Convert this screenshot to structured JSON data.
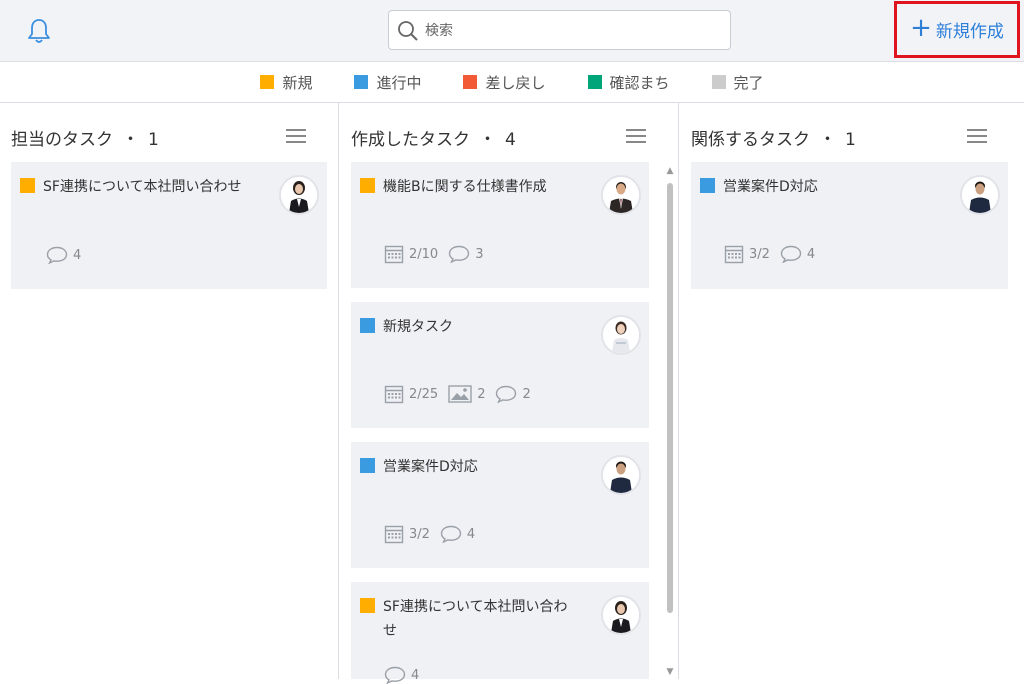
{
  "header": {
    "search_placeholder": "検索",
    "new_button_label": "新規作成"
  },
  "legend": [
    {
      "label": "新規",
      "color": "#ffae00"
    },
    {
      "label": "進行中",
      "color": "#3b9be0"
    },
    {
      "label": "差し戻し",
      "color": "#f15a35"
    },
    {
      "label": "確認まち",
      "color": "#00a679"
    },
    {
      "label": "完了",
      "color": "#cccccc"
    }
  ],
  "columns": [
    {
      "title": "担当のタスク",
      "separator": "・",
      "count": "1",
      "cards": [
        {
          "title": "SF連携について本社問い合わせ",
          "status_color": "#ffae00",
          "comments": "4",
          "avatar": "woman-suit"
        }
      ]
    },
    {
      "title": "作成したタスク",
      "separator": "・",
      "count": "4",
      "cards": [
        {
          "title": "機能Bに関する仕様書作成",
          "status_color": "#ffae00",
          "date": "2/10",
          "comments": "3",
          "avatar": "man-suit"
        },
        {
          "title": "新規タスク",
          "status_color": "#3b9be0",
          "date": "2/25",
          "images": "2",
          "comments": "2",
          "avatar": "woman-white"
        },
        {
          "title": "営業案件D対応",
          "status_color": "#3b9be0",
          "date": "3/2",
          "comments": "4",
          "avatar": "man-casual"
        },
        {
          "title_line1": "SF連携について本社問い合わ",
          "title_line2": "せ",
          "status_color": "#ffae00",
          "comments": "4",
          "avatar": "woman-suit"
        }
      ]
    },
    {
      "title": "関係するタスク",
      "separator": "・",
      "count": "1",
      "cards": [
        {
          "title": "営業案件D対応",
          "status_color": "#3b9be0",
          "date": "3/2",
          "comments": "4",
          "avatar": "man-casual"
        }
      ]
    }
  ]
}
